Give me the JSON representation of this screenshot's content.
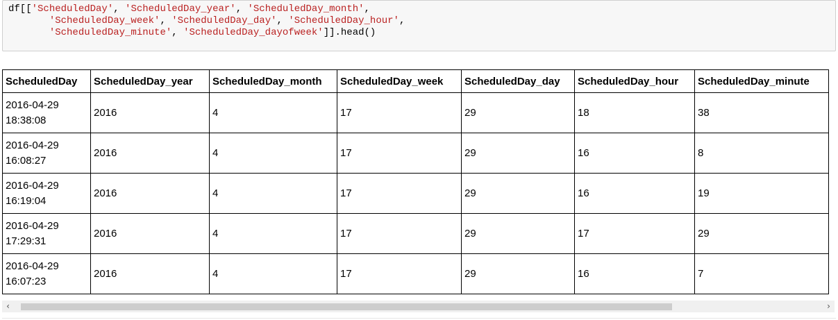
{
  "code_cell": {
    "lines": [
      "df[['ScheduledDay', 'ScheduledDay_year', 'ScheduledDay_month',",
      "       'ScheduledDay_week', 'ScheduledDay_day', 'ScheduledDay_hour',",
      "       'ScheduledDay_minute', 'ScheduledDay_dayofweek']].head()"
    ]
  },
  "table": {
    "columns": [
      "ScheduledDay",
      "ScheduledDay_year",
      "ScheduledDay_month",
      "ScheduledDay_week",
      "ScheduledDay_day",
      "ScheduledDay_hour",
      "ScheduledDay_minute"
    ],
    "rows": [
      [
        "2016-04-29 18:38:08",
        "2016",
        "4",
        "17",
        "29",
        "18",
        "38"
      ],
      [
        "2016-04-29 16:08:27",
        "2016",
        "4",
        "17",
        "29",
        "16",
        "8"
      ],
      [
        "2016-04-29 16:19:04",
        "2016",
        "4",
        "17",
        "29",
        "16",
        "19"
      ],
      [
        "2016-04-29 17:29:31",
        "2016",
        "4",
        "17",
        "29",
        "17",
        "29"
      ],
      [
        "2016-04-29 16:07:23",
        "2016",
        "4",
        "17",
        "29",
        "16",
        "7"
      ]
    ]
  },
  "scrollbar": {
    "left_arrow": "‹",
    "right_arrow": "›"
  }
}
